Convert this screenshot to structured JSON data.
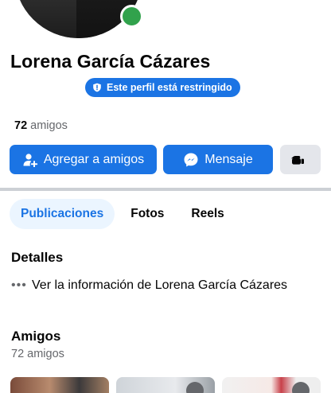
{
  "profile": {
    "name": "Lorena García Cázares",
    "restricted_label": "Este perfil está restringido",
    "friends_count_number": "72",
    "friends_count_word": " amigos",
    "online": true
  },
  "actions": {
    "add_friend_label": "Agregar a amigos",
    "message_label": "Mensaje",
    "more_icon": "hand-pointer-icon"
  },
  "tabs": [
    {
      "label": "Publicaciones",
      "active": true
    },
    {
      "label": "Fotos",
      "active": false
    },
    {
      "label": "Reels",
      "active": false
    }
  ],
  "details": {
    "heading": "Detalles",
    "dots": "•••",
    "link_text": "Ver la información de Lorena García Cázares"
  },
  "friends": {
    "heading": "Amigos",
    "subtitle": "72 amigos"
  },
  "colors": {
    "accent": "#1b74e4",
    "online": "#31a24c",
    "secondary_button": "#e4e6eb",
    "muted_text": "#65676b"
  }
}
